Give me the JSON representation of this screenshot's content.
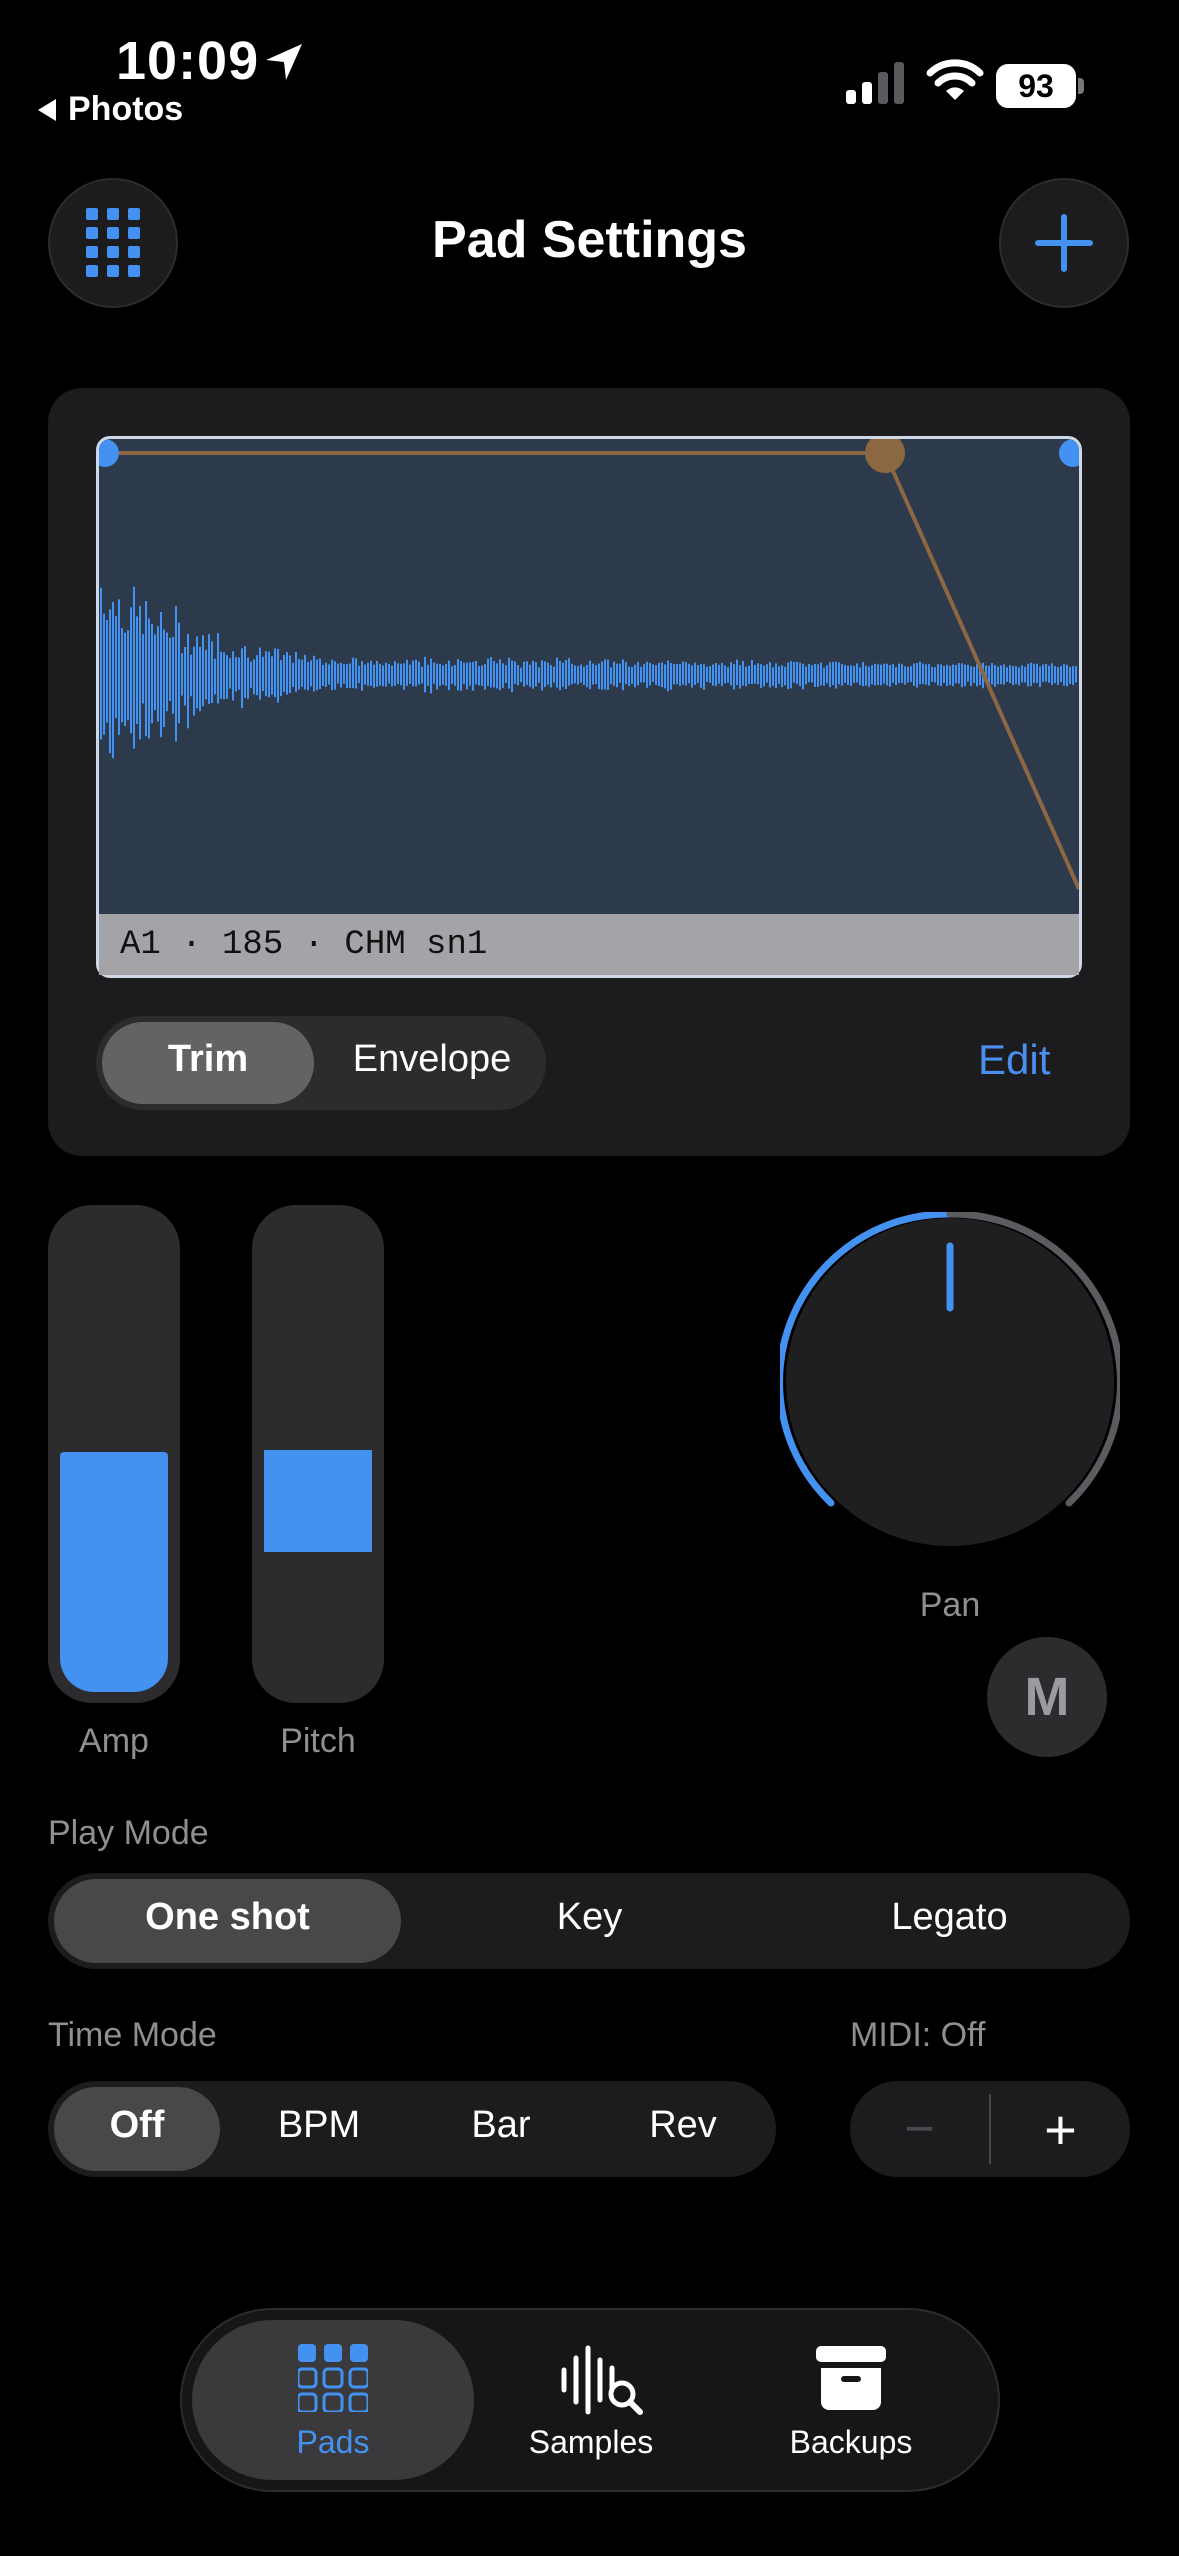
{
  "status_bar": {
    "time": "10:09",
    "back_label": "Photos",
    "battery": "93"
  },
  "header": {
    "title": "Pad Settings"
  },
  "sample": {
    "label": "A1 · 185 · CHM sn1",
    "view_tabs": [
      "Trim",
      "Envelope"
    ],
    "selected_tab": "Trim",
    "edit_label": "Edit"
  },
  "controls": {
    "amp_label": "Amp",
    "amp_level": 0.48,
    "pitch_label": "Pitch",
    "pan_label": "Pan",
    "mute_label": "M"
  },
  "play_mode": {
    "label": "Play Mode",
    "options": [
      "One shot",
      "Key",
      "Legato"
    ],
    "selected": "One shot"
  },
  "time_mode": {
    "label": "Time Mode",
    "options": [
      "Off",
      "BPM",
      "Bar",
      "Rev"
    ],
    "selected": "Off"
  },
  "midi": {
    "label": "MIDI: Off",
    "minus": "−",
    "plus": "+"
  },
  "tab_bar": {
    "tabs": [
      "Pads",
      "Samples",
      "Backups"
    ],
    "selected": "Pads"
  },
  "colors": {
    "accent": "#4391f0",
    "envelope": "#8b6842",
    "background": "#000000"
  }
}
